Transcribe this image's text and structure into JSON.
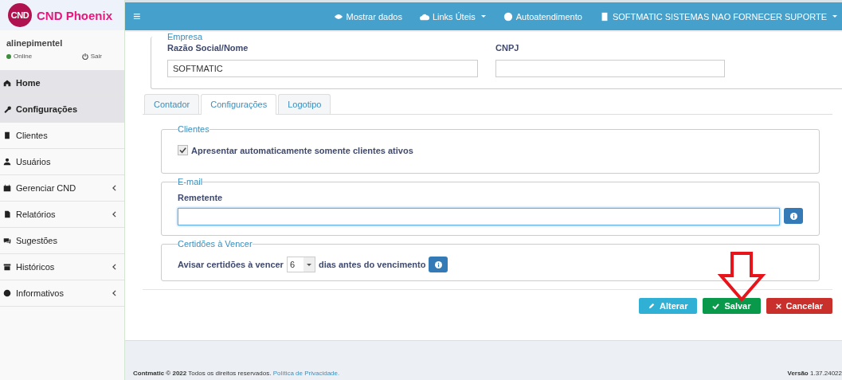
{
  "brand": {
    "logo_text": "CND",
    "name": "CND Phoenix"
  },
  "user": {
    "name": "alinepimentel",
    "status": "Online",
    "logout": "Sair"
  },
  "sidebar": {
    "items": [
      {
        "label": "Home",
        "selected": true,
        "expandable": false
      },
      {
        "label": "Configurações",
        "selected": true,
        "expandable": false
      },
      {
        "label": "Clientes",
        "selected": false,
        "expandable": false
      },
      {
        "label": "Usuários",
        "selected": false,
        "expandable": false
      },
      {
        "label": "Gerenciar CND",
        "selected": false,
        "expandable": true
      },
      {
        "label": "Relatórios",
        "selected": false,
        "expandable": true
      },
      {
        "label": "Sugestões",
        "selected": false,
        "expandable": false
      },
      {
        "label": "Históricos",
        "selected": false,
        "expandable": true
      },
      {
        "label": "Informativos",
        "selected": false,
        "expandable": true
      }
    ]
  },
  "topbar": {
    "menu_icon": "≡",
    "items": [
      {
        "label": "Mostrar dados",
        "dropdown": false
      },
      {
        "label": "Links Úteis",
        "dropdown": true
      },
      {
        "label": "Autoatendimento",
        "dropdown": false
      },
      {
        "label": "SOFTMATIC SISTEMAS NAO FORNECER SUPORTE",
        "dropdown": true
      }
    ]
  },
  "empresa": {
    "legend": "Empresa",
    "fields": [
      {
        "label": "Razão Social/Nome",
        "value": "SOFTMATIC"
      },
      {
        "label": "CNPJ"
      }
    ]
  },
  "tabs": [
    {
      "label": "Contador",
      "selected": false
    },
    {
      "label": "Configurações",
      "selected": true
    },
    {
      "label": "Logotipo",
      "selected": false
    }
  ],
  "clientes": {
    "legend": "Clientes",
    "checkbox": {
      "label": "Apresentar automaticamente somente clientes ativos",
      "checked": true
    }
  },
  "email": {
    "legend": "E-mail",
    "label": "Remetente"
  },
  "certidoes": {
    "legend": "Certidões à Vencer",
    "before": "Avisar certidões à vencer",
    "value": "6",
    "after": "dias antes do vencimento"
  },
  "buttons": [
    {
      "label": "Alterar",
      "kind": "edit"
    },
    {
      "label": "Salvar",
      "kind": "save"
    },
    {
      "label": "Cancelar",
      "kind": "cancel"
    }
  ],
  "footer": {
    "text": "**Contmatic © 2022** Todos os direitos reservados.",
    "link": "Política de Privacidade.",
    "version_label": "Versão",
    "version": "1.37.24022"
  }
}
